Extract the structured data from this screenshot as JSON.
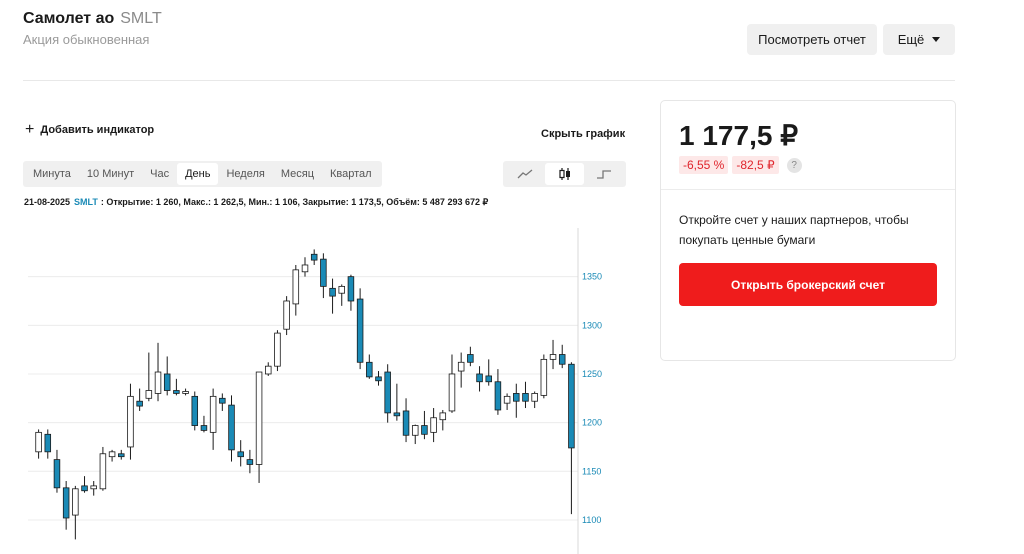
{
  "stock": {
    "name": "Самолет ао",
    "ticker": "SMLT",
    "type": "Акция обыкновенная"
  },
  "actions": {
    "report_label": "Посмотреть отчет",
    "more_label": "Ещё"
  },
  "chart_controls": {
    "add_indicator": "Добавить индикатор",
    "hide_chart": "Скрыть график",
    "periods": [
      "Минута",
      "10 Минут",
      "Час",
      "День",
      "Неделя",
      "Месяц",
      "Квартал"
    ],
    "active_period": "День",
    "chart_types": [
      "line-chart-icon",
      "candlestick-icon",
      "step-chart-icon"
    ],
    "active_chart_type": "candlestick-icon"
  },
  "ohlc_info": {
    "date": "21-08-2025",
    "ticker": "SMLT",
    "text": ": Открытие: 1 260, Макс.: 1 262,5, Мин.: 1 106, Закрытие: 1 173,5, Объём: 5 487 293 672 ₽"
  },
  "quote": {
    "price": "1 177,5 ₽",
    "change_pct": "-6,55 %",
    "change_abs": "-82,5 ₽",
    "help": "?"
  },
  "partner": {
    "text": "Откройте счет у наших партнеров, чтобы покупать ценные бумаги",
    "button_label": "Открыть брокерский счет"
  },
  "colors": {
    "accent_red": "#ef1c1c",
    "candle_down": "#1a8ab6",
    "candle_up": "#ffffff",
    "axis_label": "#1a8ab6"
  },
  "chart_data": {
    "type": "candlestick",
    "y_ticks": [
      1100,
      1150,
      1200,
      1250,
      1300,
      1350
    ],
    "ylim": [
      1065,
      1400
    ],
    "grid": true,
    "candles": [
      {
        "o": 1170,
        "h": 1193,
        "l": 1163,
        "c": 1190
      },
      {
        "o": 1188,
        "h": 1193,
        "l": 1163,
        "c": 1170
      },
      {
        "o": 1162,
        "h": 1172,
        "l": 1128,
        "c": 1133
      },
      {
        "o": 1133,
        "h": 1140,
        "l": 1090,
        "c": 1102
      },
      {
        "o": 1105,
        "h": 1135,
        "l": 1080,
        "c": 1132
      },
      {
        "o": 1135,
        "h": 1145,
        "l": 1128,
        "c": 1130
      },
      {
        "o": 1132,
        "h": 1140,
        "l": 1125,
        "c": 1135
      },
      {
        "o": 1132,
        "h": 1175,
        "l": 1130,
        "c": 1168
      },
      {
        "o": 1165,
        "h": 1172,
        "l": 1160,
        "c": 1170
      },
      {
        "o": 1168,
        "h": 1172,
        "l": 1162,
        "c": 1165
      },
      {
        "o": 1175,
        "h": 1240,
        "l": 1162,
        "c": 1227
      },
      {
        "o": 1222,
        "h": 1235,
        "l": 1212,
        "c": 1217
      },
      {
        "o": 1225,
        "h": 1272,
        "l": 1222,
        "c": 1233
      },
      {
        "o": 1230,
        "h": 1282,
        "l": 1222,
        "c": 1252
      },
      {
        "o": 1250,
        "h": 1268,
        "l": 1228,
        "c": 1233
      },
      {
        "o": 1233,
        "h": 1245,
        "l": 1228,
        "c": 1230
      },
      {
        "o": 1230,
        "h": 1235,
        "l": 1228,
        "c": 1232
      },
      {
        "o": 1227,
        "h": 1232,
        "l": 1192,
        "c": 1197
      },
      {
        "o": 1197,
        "h": 1207,
        "l": 1190,
        "c": 1192
      },
      {
        "o": 1190,
        "h": 1235,
        "l": 1172,
        "c": 1227
      },
      {
        "o": 1225,
        "h": 1230,
        "l": 1212,
        "c": 1220
      },
      {
        "o": 1218,
        "h": 1228,
        "l": 1160,
        "c": 1172
      },
      {
        "o": 1170,
        "h": 1182,
        "l": 1155,
        "c": 1165
      },
      {
        "o": 1162,
        "h": 1172,
        "l": 1148,
        "c": 1157
      },
      {
        "o": 1157,
        "h": 1252,
        "l": 1138,
        "c": 1252
      },
      {
        "o": 1250,
        "h": 1262,
        "l": 1248,
        "c": 1258
      },
      {
        "o": 1258,
        "h": 1295,
        "l": 1253,
        "c": 1292
      },
      {
        "o": 1296,
        "h": 1330,
        "l": 1290,
        "c": 1325
      },
      {
        "o": 1322,
        "h": 1362,
        "l": 1310,
        "c": 1357
      },
      {
        "o": 1355,
        "h": 1370,
        "l": 1350,
        "c": 1362
      },
      {
        "o": 1373,
        "h": 1378,
        "l": 1362,
        "c": 1367
      },
      {
        "o": 1368,
        "h": 1374,
        "l": 1328,
        "c": 1340
      },
      {
        "o": 1338,
        "h": 1348,
        "l": 1312,
        "c": 1330
      },
      {
        "o": 1333,
        "h": 1342,
        "l": 1320,
        "c": 1340
      },
      {
        "o": 1350,
        "h": 1352,
        "l": 1315,
        "c": 1325
      },
      {
        "o": 1327,
        "h": 1338,
        "l": 1255,
        "c": 1262
      },
      {
        "o": 1262,
        "h": 1270,
        "l": 1245,
        "c": 1247
      },
      {
        "o": 1247,
        "h": 1253,
        "l": 1238,
        "c": 1243
      },
      {
        "o": 1252,
        "h": 1260,
        "l": 1200,
        "c": 1210
      },
      {
        "o": 1210,
        "h": 1240,
        "l": 1202,
        "c": 1207
      },
      {
        "o": 1212,
        "h": 1225,
        "l": 1180,
        "c": 1187
      },
      {
        "o": 1187,
        "h": 1198,
        "l": 1178,
        "c": 1197
      },
      {
        "o": 1197,
        "h": 1212,
        "l": 1183,
        "c": 1188
      },
      {
        "o": 1190,
        "h": 1215,
        "l": 1180,
        "c": 1205
      },
      {
        "o": 1203,
        "h": 1213,
        "l": 1192,
        "c": 1210
      },
      {
        "o": 1212,
        "h": 1270,
        "l": 1210,
        "c": 1250
      },
      {
        "o": 1253,
        "h": 1272,
        "l": 1236,
        "c": 1262
      },
      {
        "o": 1270,
        "h": 1278,
        "l": 1258,
        "c": 1262
      },
      {
        "o": 1250,
        "h": 1258,
        "l": 1232,
        "c": 1242
      },
      {
        "o": 1248,
        "h": 1265,
        "l": 1238,
        "c": 1242
      },
      {
        "o": 1242,
        "h": 1255,
        "l": 1208,
        "c": 1213
      },
      {
        "o": 1220,
        "h": 1230,
        "l": 1213,
        "c": 1227
      },
      {
        "o": 1230,
        "h": 1240,
        "l": 1205,
        "c": 1222
      },
      {
        "o": 1230,
        "h": 1242,
        "l": 1215,
        "c": 1222
      },
      {
        "o": 1222,
        "h": 1232,
        "l": 1215,
        "c": 1230
      },
      {
        "o": 1228,
        "h": 1270,
        "l": 1225,
        "c": 1265
      },
      {
        "o": 1265,
        "h": 1285,
        "l": 1255,
        "c": 1270
      },
      {
        "o": 1270,
        "h": 1280,
        "l": 1256,
        "c": 1260
      },
      {
        "o": 1260,
        "h": 1262,
        "l": 1106,
        "c": 1174
      }
    ]
  }
}
